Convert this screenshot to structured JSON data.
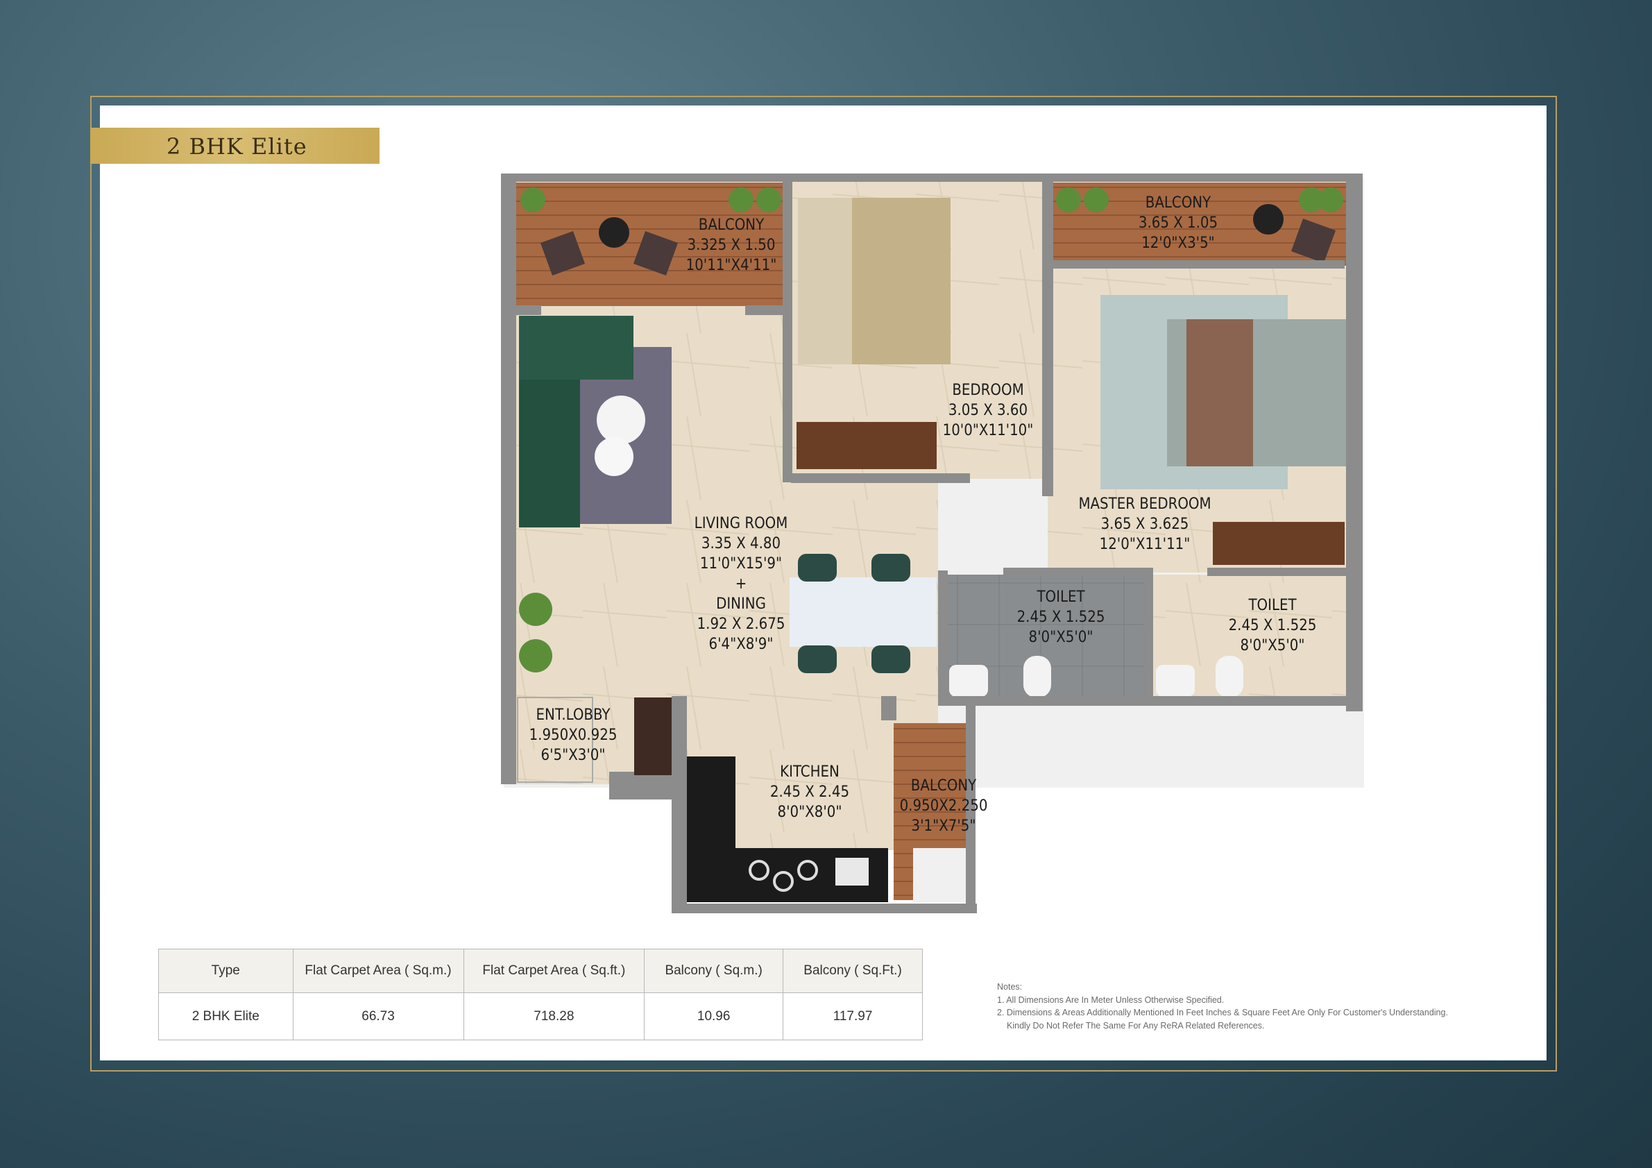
{
  "banner": {
    "title": "2 BHK Elite"
  },
  "rooms": {
    "balcony_left": {
      "name": "BALCONY",
      "dim_m": "3.325 X 1.50",
      "dim_ft": "10'11\"X4'11\""
    },
    "bedroom": {
      "name": "BEDROOM",
      "dim_m": "3.05 X 3.60",
      "dim_ft": "10'0\"X11'10\""
    },
    "balcony_right": {
      "name": "BALCONY",
      "dim_m": "3.65 X 1.05",
      "dim_ft": "12'0\"X3'5\""
    },
    "master_bedroom": {
      "name": "MASTER BEDROOM",
      "dim_m": "3.65 X 3.625",
      "dim_ft": "12'0\"X11'11\""
    },
    "living_room": {
      "name": "LIVING ROOM",
      "dim_m": "3.35 X 4.80",
      "dim_ft": "11'0\"X15'9\"",
      "plus": "+"
    },
    "dining": {
      "name": "DINING",
      "dim_m": "1.92 X 2.675",
      "dim_ft": "6'4\"X8'9\""
    },
    "toilet_1": {
      "name": "TOILET",
      "dim_m": "2.45 X 1.525",
      "dim_ft": "8'0\"X5'0\""
    },
    "toilet_2": {
      "name": "TOILET",
      "dim_m": "2.45 X 1.525",
      "dim_ft": "8'0\"X5'0\""
    },
    "ent_lobby": {
      "name": "ENT.LOBBY",
      "dim_m": "1.950X0.925",
      "dim_ft": "6'5\"X3'0\""
    },
    "kitchen": {
      "name": "KITCHEN",
      "dim_m": "2.45 X 2.45",
      "dim_ft": "8'0\"X8'0\""
    },
    "balcony_kitchen": {
      "name": "BALCONY",
      "dim_m": "0.950X2.250",
      "dim_ft": "3'1\"X7'5\""
    }
  },
  "table": {
    "headers": [
      "Type",
      "Flat Carpet Area ( Sq.m.)",
      "Flat Carpet Area ( Sq.ft.)",
      "Balcony ( Sq.m.)",
      "Balcony ( Sq.Ft.)"
    ],
    "row": [
      "2 BHK Elite",
      "66.73",
      "718.28",
      "10.96",
      "117.97"
    ]
  },
  "notes": {
    "title": "Notes:",
    "line1": "1.  All Dimensions Are In Meter Unless Otherwise Specified.",
    "line2": "2.  Dimensions & Areas Additionally Mentioned In Feet Inches & Square Feet Are Only For Customer's Understanding.",
    "line3": "Kindly Do Not Refer The Same For Any ReRA Related References."
  }
}
